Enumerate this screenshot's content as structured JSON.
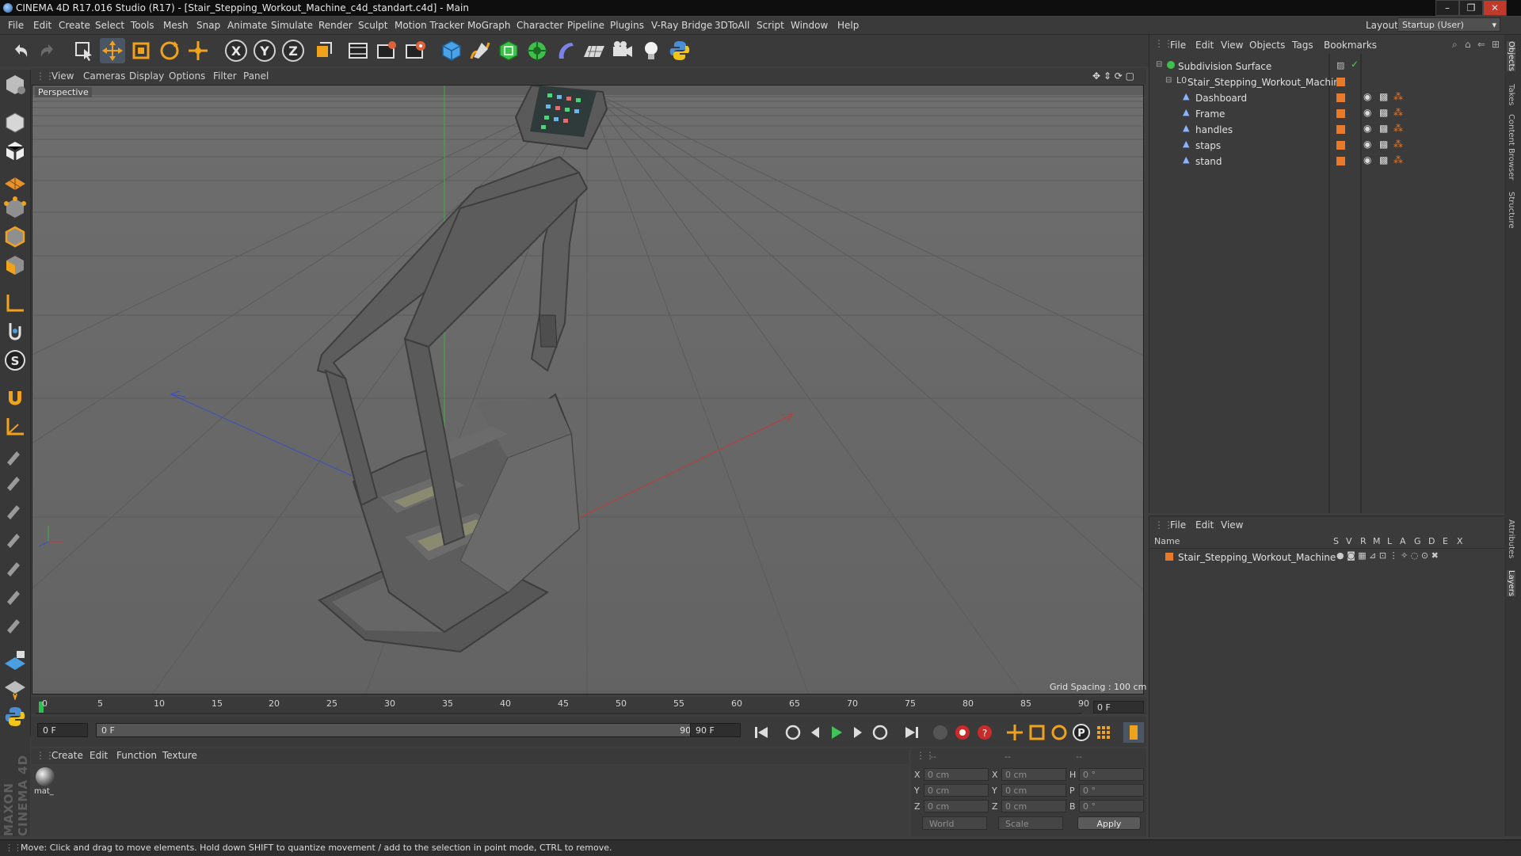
{
  "window": {
    "title": "CINEMA 4D R17.016 Studio (R17) - [Stair_Stepping_Workout_Machine_c4d_standart.c4d] - Main",
    "controls": [
      "–",
      "❐",
      "✕"
    ]
  },
  "menubar": {
    "items": [
      "File",
      "Edit",
      "Create",
      "Select",
      "Tools",
      "Mesh",
      "Snap",
      "Animate",
      "Simulate",
      "Render",
      "Sculpt",
      "Motion Tracker",
      "MoGraph",
      "Character",
      "Pipeline",
      "Plugins",
      "V-Ray Bridge",
      "3DToAll",
      "Script",
      "Window",
      "Help"
    ],
    "layout_label": "Layout:",
    "layout_value": "Startup (User)"
  },
  "toolbar": {
    "icons": [
      "undo-icon",
      "redo-icon",
      "live-selection-icon",
      "move-icon",
      "scale-icon",
      "rotate-icon",
      "transform-icon",
      "x-axis-icon",
      "y-axis-icon",
      "z-axis-icon",
      "coordinate-system-icon",
      "render-view-icon",
      "render-picture-viewer-icon",
      "render-settings-icon",
      "cube-primitive-icon",
      "spline-pen-icon",
      "subdivision-nurbs-icon",
      "array-icon",
      "deformer-icon",
      "floor-icon",
      "camera-icon",
      "light-icon",
      "python-icon"
    ],
    "axis_labels": [
      "X",
      "Y",
      "Z"
    ]
  },
  "viewport": {
    "menu": [
      "View",
      "Cameras",
      "Display",
      "Options",
      "Filter",
      "Panel"
    ],
    "label": "Perspective",
    "grid_spacing": "Grid Spacing : 100 cm"
  },
  "timeline": {
    "ticks": [
      "0",
      "5",
      "10",
      "15",
      "20",
      "25",
      "30",
      "35",
      "40",
      "45",
      "50",
      "55",
      "60",
      "65",
      "70",
      "75",
      "80",
      "85",
      "90"
    ],
    "current_frame": "0 F",
    "start_field": "0 F",
    "range_start": "0 F",
    "range_end": "90 F",
    "end_field": "90 F"
  },
  "material_manager": {
    "menu": [
      "Create",
      "Edit",
      "Function",
      "Texture"
    ],
    "material_name": "mat_"
  },
  "coordinates": {
    "header": [
      "--",
      "--",
      "--"
    ],
    "rows": [
      {
        "a": "X",
        "a_val": "0 cm",
        "b": "X",
        "b_val": "0 cm",
        "c": "H",
        "c_val": "0 °"
      },
      {
        "a": "Y",
        "a_val": "0 cm",
        "b": "Y",
        "b_val": "0 cm",
        "c": "P",
        "c_val": "0 °"
      },
      {
        "a": "Z",
        "a_val": "0 cm",
        "b": "Z",
        "b_val": "0 cm",
        "c": "B",
        "c_val": "0 °"
      }
    ],
    "mode": "World",
    "transform": "Scale",
    "apply_label": "Apply"
  },
  "object_manager": {
    "menu": [
      "File",
      "Edit",
      "View",
      "Objects",
      "Tags",
      "Bookmarks"
    ],
    "objects": [
      {
        "name": "Subdivision Surface",
        "indent": 0
      },
      {
        "name": "Stair_Stepping_Workout_Machine",
        "indent": 1
      },
      {
        "name": "Dashboard",
        "indent": 2
      },
      {
        "name": "Frame",
        "indent": 2
      },
      {
        "name": "handles",
        "indent": 2
      },
      {
        "name": "staps",
        "indent": 2
      },
      {
        "name": "stand",
        "indent": 2
      }
    ]
  },
  "layer_manager": {
    "menu": [
      "File",
      "Edit",
      "View"
    ],
    "columns": [
      "Name",
      "S",
      "V",
      "R",
      "M",
      "L",
      "A",
      "G",
      "D",
      "E",
      "X"
    ],
    "layers": [
      "Stair_Stepping_Workout_Machine"
    ]
  },
  "side_tabs": [
    "Objects",
    "Takes",
    "Content Browser",
    "Structure",
    "Attributes",
    "Layers"
  ],
  "statusbar": {
    "text": "Move: Click and drag to move elements. Hold down SHIFT to quantize movement / add to the selection in point mode, CTRL to remove."
  },
  "branding": {
    "logo_text": "MAXON CINEMA 4D"
  },
  "colors": {
    "accent_orange": "#e87a2a",
    "axis_x": "#c23a3a",
    "axis_y": "#3fae3f",
    "axis_z": "#3a4fc2",
    "highlight_blue": "#4a9fe0"
  }
}
